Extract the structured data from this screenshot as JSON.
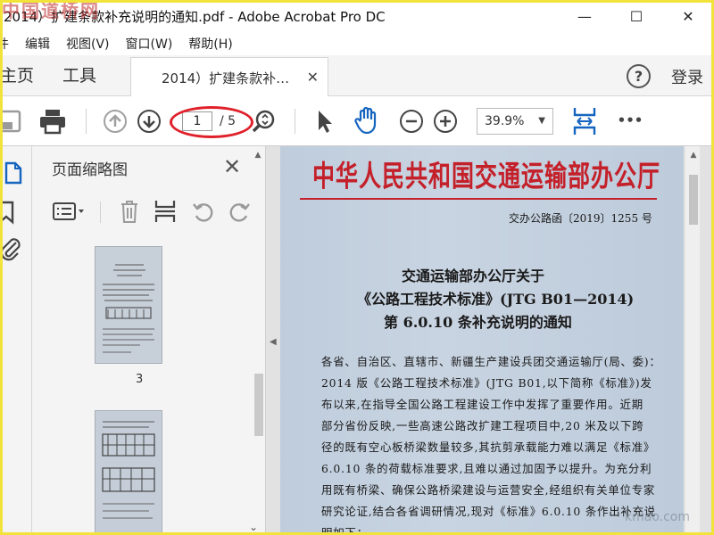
{
  "window": {
    "title": "2014）扩建条款补充说明的通知.pdf - Adobe Acrobat Pro DC",
    "watermark": "中国道桥网",
    "minimize": "—",
    "maximize": "☐",
    "close": "✕"
  },
  "menu": {
    "items": [
      "件",
      "编辑",
      "视图(V)",
      "窗口(W)",
      "帮助(H)"
    ]
  },
  "tabs": {
    "home": "主页",
    "tools": "工具",
    "doc_tab": "2014）扩建条款补…",
    "doc_tab_close": "✕",
    "help": "?",
    "login": "登录"
  },
  "toolbar": {
    "page_current": "1",
    "page_total": "/ 5",
    "zoom": "39.9%",
    "more": "•••",
    "icons": [
      "save-icon",
      "print-icon",
      "prev-page-icon",
      "next-page-icon",
      "zoom-search-icon",
      "select-arrow-icon",
      "hand-tool-icon",
      "zoom-out-icon",
      "zoom-in-icon",
      "fit-page-icon",
      "more-icon"
    ],
    "annotation_color": "#e0202a"
  },
  "panel": {
    "title": "页面缩略图",
    "close": "✕",
    "thumb_page_label": "3"
  },
  "document": {
    "org": "中华人民共和国交通运输部办公厅",
    "doc_no": "交办公路函〔2019〕1255 号",
    "title_line1": "交通运输部办公厅关于",
    "title_line2": "《公路工程技术标准》(JTG B01—2014)",
    "title_line3": "第 6.0.10 条补充说明的通知",
    "body_lines": [
      "各省、自治区、直辖市、新疆生产建设兵团交通运输厅(局、委)：",
      "  2014 版《公路工程技术标准》(JTG B01,以下简称《标准》)发",
      "布以来,在指导全国公路工程建设工作中发挥了重要作用。近期",
      "部分省份反映,一些高速公路改扩建工程项目中,20 米及以下跨",
      "径的既有空心板桥梁数量较多,其抗剪承载能力难以满足《标准》",
      "6.0.10 条的荷载标准要求,且难以通过加固予以提升。为充分利",
      "用既有桥梁、确保公路桥梁建设与运营安全,经组织有关单位专家",
      "研究论证,结合各省调研情况,现对《标准》6.0.10 条作出补充说",
      "明如下："
    ],
    "corner_watermark": "kmao.com",
    "org_color": "#c4202a"
  }
}
